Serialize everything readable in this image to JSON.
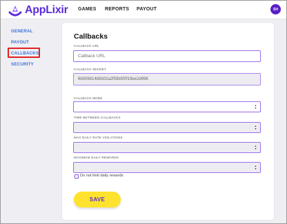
{
  "header": {
    "logo_text": "AppLixir",
    "nav": [
      "GAMES",
      "REPORTS",
      "PAYOUT"
    ],
    "avatar_initials": "SH"
  },
  "sidebar": {
    "items": [
      {
        "label": "GENERAL"
      },
      {
        "label": "PAYOUT"
      },
      {
        "label": "CALLBACKS",
        "active": true
      },
      {
        "label": "SECURITY"
      }
    ]
  },
  "callbacks": {
    "title": "Callbacks",
    "callback_url": {
      "label": "CALLBACK URL",
      "placeholder": "Callback URL",
      "value": ""
    },
    "callback_secret": {
      "label": "CALLBACK SECRET",
      "value": "6b506814b5b02a2f59b5f0f19ee2d996"
    },
    "callback_mode": {
      "label": "CALLBACK MODE",
      "value": ""
    },
    "time_between": {
      "label": "TIME BETWEEN CALLBACKS",
      "value": ""
    },
    "max_daily_violations": {
      "label": "MAX DAILY RATE VIOLATIONS",
      "value": ""
    },
    "max_daily_rewards": {
      "label": "MAXIMUM DAILY REWARDS",
      "value": ""
    },
    "no_limit_checkbox": {
      "label": "Do not limit daily rewards",
      "checked": false
    },
    "save_label": "SAVE"
  },
  "colors": {
    "brand_purple": "#5b2bd8",
    "save_yellow": "#ffe22e",
    "sidebar_link": "#3a6fd8",
    "highlight_red": "#e02020"
  }
}
